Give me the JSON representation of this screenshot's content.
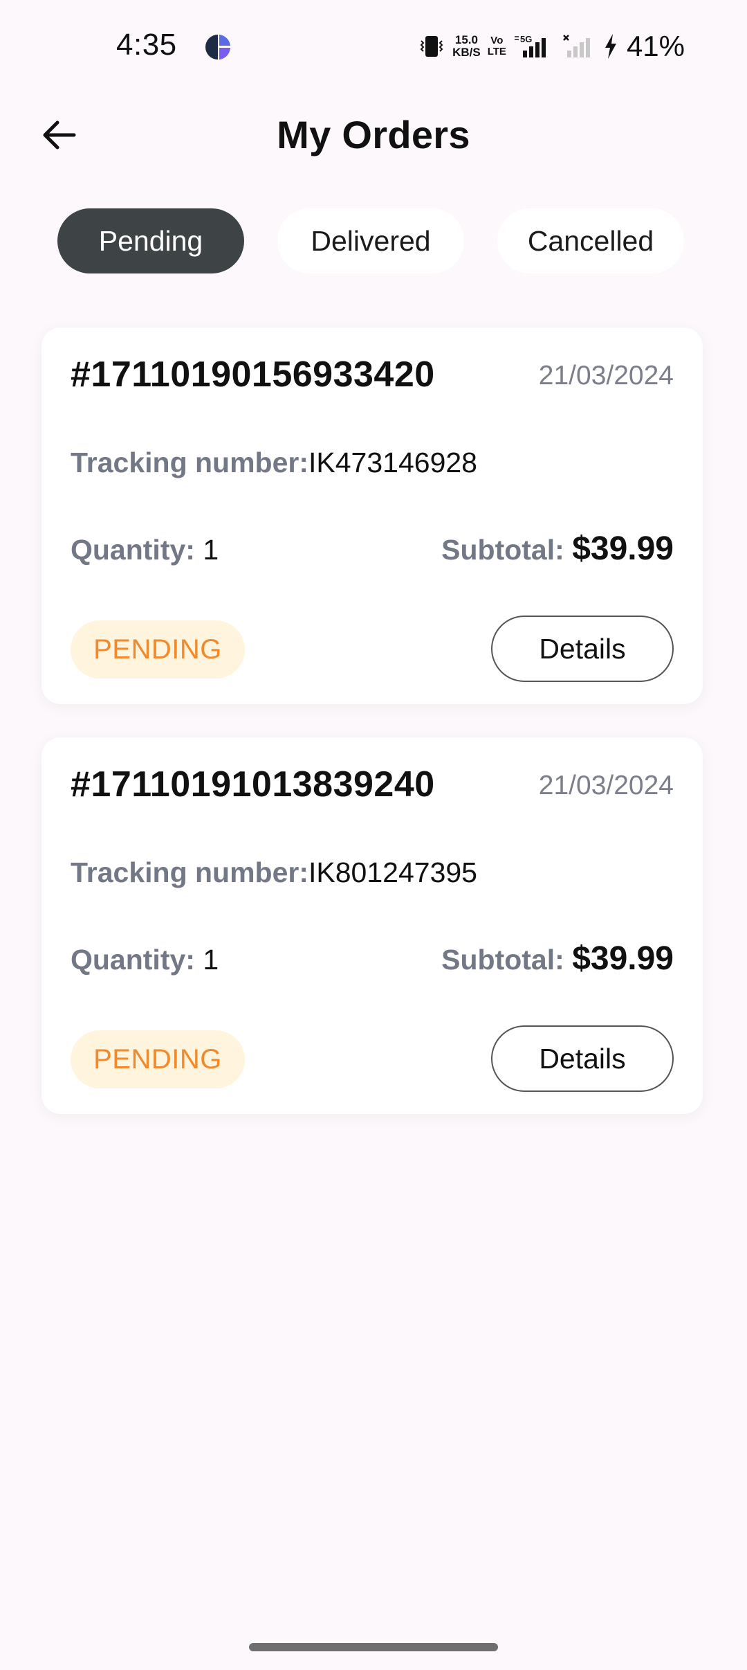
{
  "status_bar": {
    "time": "4:35",
    "net_speed_value": "15.0",
    "net_speed_unit": "KB/S",
    "volte_top": "Vo",
    "volte_bottom": "LTE",
    "network_type": "5G",
    "battery": "41%",
    "icons": [
      "vibrate-icon",
      "signal-5g-icon",
      "signal-no-service-icon",
      "charging-bolt-icon"
    ]
  },
  "header": {
    "title": "My Orders",
    "back_icon": "arrow-left-icon"
  },
  "tabs": [
    {
      "label": "Pending",
      "active": true
    },
    {
      "label": "Delivered",
      "active": false
    },
    {
      "label": "Cancelled",
      "active": false
    }
  ],
  "orders": [
    {
      "id": "#17110190156933420",
      "date": "21/03/2024",
      "tracking_label": "Tracking number:",
      "tracking_number": "IK473146928",
      "quantity_label": "Quantity:",
      "quantity": "1",
      "subtotal_label": "Subtotal:",
      "subtotal": "$39.99",
      "status": "PENDING",
      "details_label": "Details"
    },
    {
      "id": "#17110191013839240",
      "date": "21/03/2024",
      "tracking_label": "Tracking number:",
      "tracking_number": "IK801247395",
      "quantity_label": "Quantity:",
      "quantity": "1",
      "subtotal_label": "Subtotal:",
      "subtotal": "$39.99",
      "status": "PENDING",
      "details_label": "Details"
    }
  ],
  "colors": {
    "background": "#FDF8FC",
    "active_tab": "#3E4345",
    "pending_text": "#F18A2C",
    "pending_bg": "#FFF4DE",
    "muted_label": "#737886"
  }
}
